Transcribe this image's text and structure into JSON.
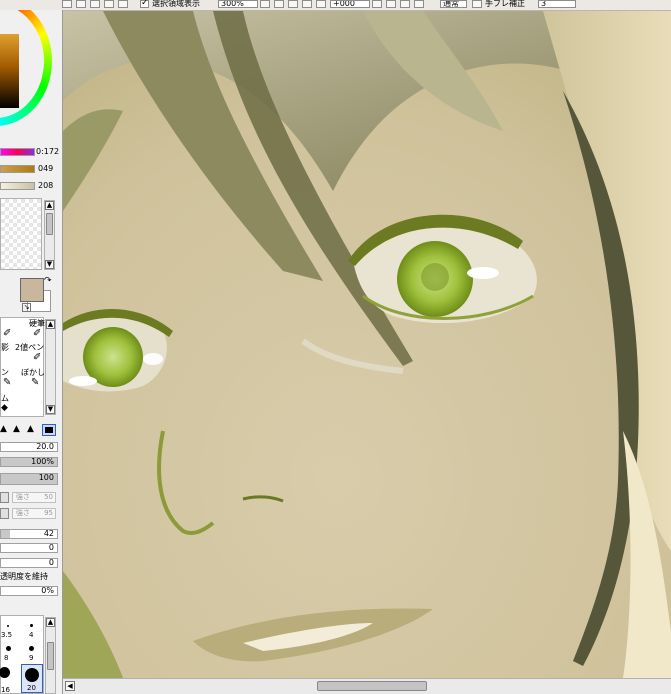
{
  "toolbar": {
    "selection_checkbox_label": "選択領域表示",
    "zoom": "300%",
    "rotation": "+000",
    "mode": "通常",
    "stabilizer_label": "手ブレ補正",
    "stabilizer_value": "3"
  },
  "color": {
    "wheel_accent": "#c9a46a",
    "sliders": [
      {
        "value": "0:172",
        "gradient": "linear-gradient(90deg,#ff00ff,#ff0050,#8a2be2)"
      },
      {
        "value": "049",
        "gradient": "linear-gradient(90deg,#c9a050,#b07a10)"
      },
      {
        "value": "208",
        "gradient": "linear-gradient(90deg,#f5efe0,#cbbfa6)"
      }
    ],
    "foreground": "#c8b79c"
  },
  "tools": [
    {
      "label": "硬筆"
    },
    {
      "label": "影"
    },
    {
      "label": "2値ペン"
    },
    {
      "label": "ン"
    },
    {
      "label": "ぼかし"
    },
    {
      "label": "ム"
    }
  ],
  "brush": {
    "size": "20.0",
    "min_size": "100%",
    "density": "100",
    "option1_label": "強さ",
    "option1_value": "50",
    "option2_label": "強さ",
    "option2_value": "95",
    "value_a": "42",
    "value_b": "0",
    "value_c": "0",
    "preserve_opacity_label": "透明度を維持",
    "preserve_value": "0%"
  },
  "brush_sizes": [
    {
      "label": "3.5"
    },
    {
      "label": "4"
    },
    {
      "label": "8"
    },
    {
      "label": "9"
    },
    {
      "label": "16"
    },
    {
      "label": "20"
    }
  ]
}
